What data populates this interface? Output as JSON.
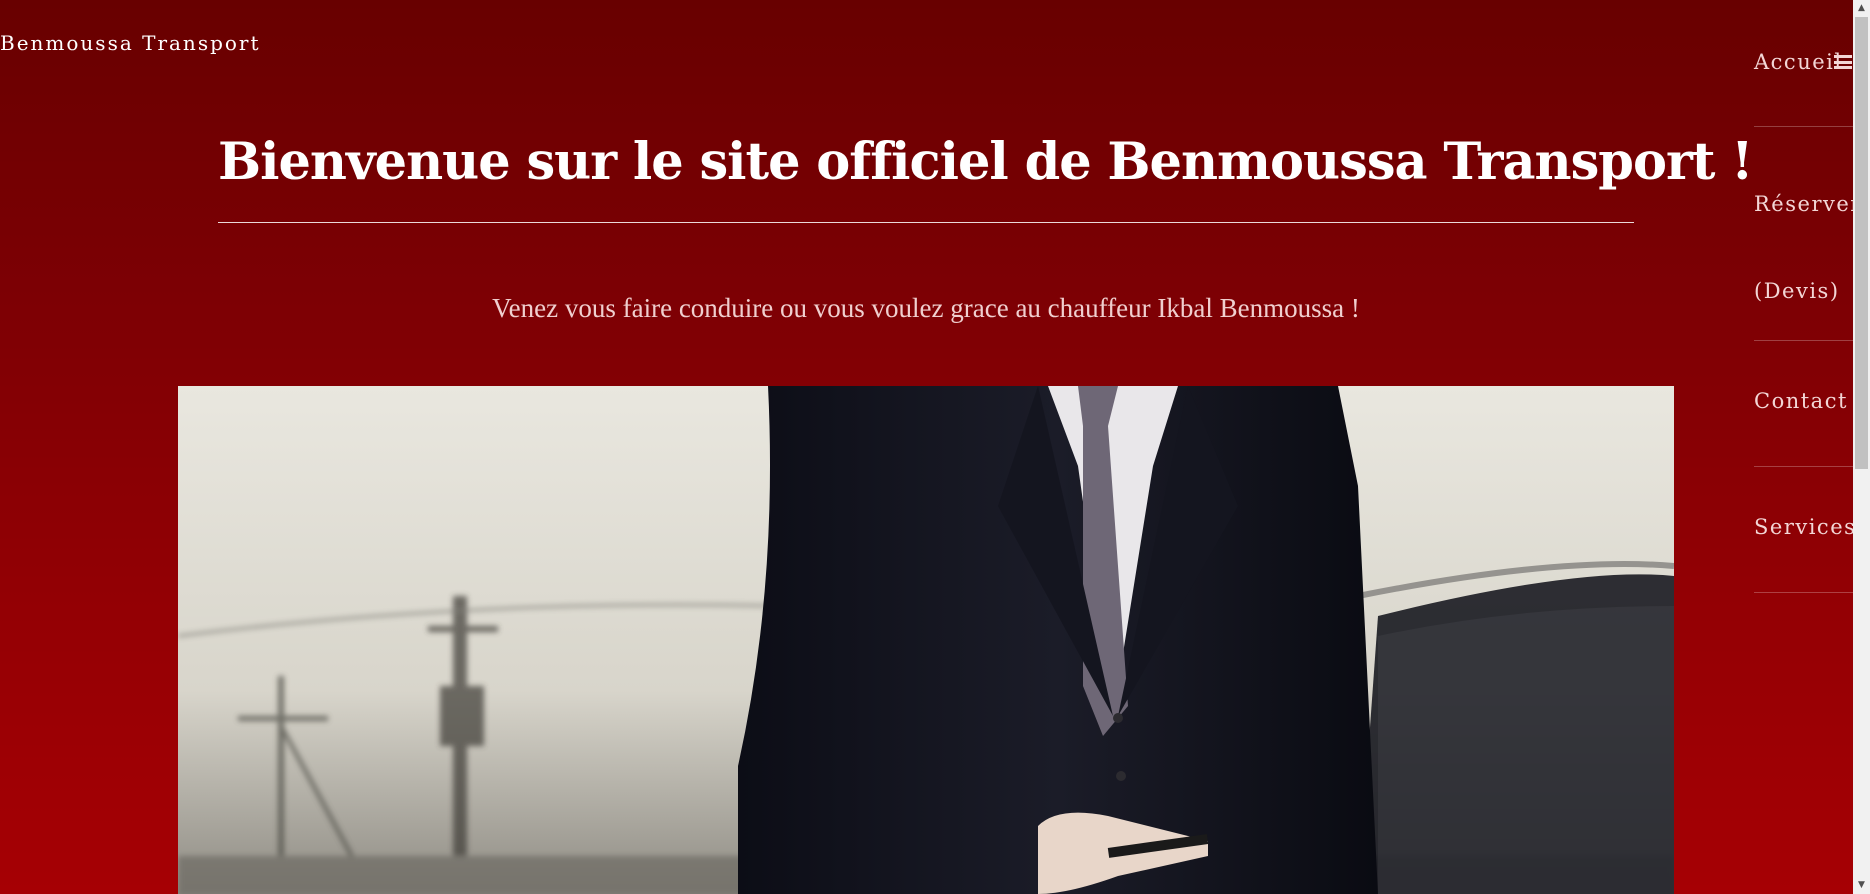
{
  "header": {
    "brand": "Benmoussa Transport"
  },
  "nav": {
    "items": [
      {
        "label": "Accueil"
      },
      {
        "label": "Réserver (Devis)"
      },
      {
        "label": "Contact"
      },
      {
        "label": "Services"
      }
    ],
    "menu_icon": "hamburger-menu-icon"
  },
  "hero": {
    "title": "Bienvenue sur le site officiel de Benmoussa Transport !",
    "subtitle": "Venez vous faire conduire ou vous voulez grace au chauffeur Ikbal Benmoussa !"
  },
  "colors": {
    "background_top": "#680000",
    "background_bottom": "#a60004",
    "text": "#ffffff",
    "nav_text": "#f3d6d6"
  }
}
